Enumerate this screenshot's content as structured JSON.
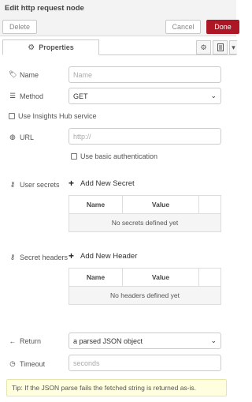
{
  "header": {
    "title": "Edit http request node",
    "delete_label": "Delete",
    "cancel_label": "Cancel",
    "done_label": "Done"
  },
  "tabs": {
    "properties_label": "Properties"
  },
  "form": {
    "name": {
      "label": "Name",
      "placeholder": "Name",
      "value": ""
    },
    "method": {
      "label": "Method",
      "value": "GET"
    },
    "insights_hub": {
      "label": "Use Insights Hub service",
      "checked": false
    },
    "url": {
      "label": "URL",
      "placeholder": "http://",
      "value": ""
    },
    "basic_auth": {
      "label": "Use basic authentication",
      "checked": false
    },
    "user_secrets": {
      "label": "User secrets",
      "add_label": "Add New Secret",
      "columns": [
        "Name",
        "Value",
        ""
      ],
      "empty_text": "No secrets defined yet"
    },
    "secret_headers": {
      "label": "Secret headers",
      "add_label": "Add New Header",
      "columns": [
        "Name",
        "Value",
        ""
      ],
      "empty_text": "No headers defined yet"
    },
    "return": {
      "label": "Return",
      "value": "a parsed JSON object"
    },
    "timeout": {
      "label": "Timeout",
      "placeholder": "seconds",
      "value": ""
    },
    "tip": "Tip: If the JSON parse fails the fetched string is returned as-is."
  },
  "colors": {
    "done_button": "#ad1625",
    "tip_background": "#ffffe0",
    "header_background": "#f3f3f3"
  }
}
